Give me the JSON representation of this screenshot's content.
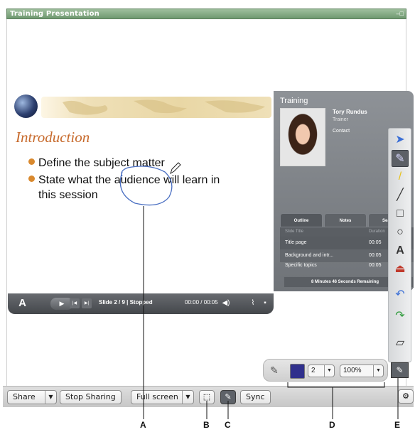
{
  "window": {
    "title": "Training Presentation",
    "controls": "–□"
  },
  "slide": {
    "title": "Introduction",
    "bullets": [
      "Define the subject matter",
      "State what the audience will learn in",
      "this session"
    ]
  },
  "player": {
    "slide_info": "Slide 2 / 9 | Stopped",
    "time": "00:00 / 00:05"
  },
  "presenter": {
    "heading": "Training",
    "name": "Tory Rundus",
    "role": "Trainer",
    "contact": "Contact"
  },
  "outline": {
    "tabs": [
      "Outline",
      "Notes",
      "Search"
    ],
    "header": {
      "left": "Slide Title",
      "right": "Duration"
    },
    "rows": [
      {
        "title": "Title page",
        "time": "00:05"
      },
      {
        "title": "Background and intr...",
        "time": "00:05"
      },
      {
        "title": "Specific topics",
        "time": "00:05"
      }
    ],
    "remaining": "8 Minutes 46 Seconds Remaining"
  },
  "drawing_tools": [
    "pointer-icon",
    "pen-icon",
    "highlighter-icon",
    "line-icon",
    "rectangle-icon",
    "ellipse-icon",
    "text-icon",
    "stamp-icon",
    "undo-icon",
    "redo-icon",
    "eraser-icon"
  ],
  "pen_options": {
    "color": "#2f2f8c",
    "thickness": "2",
    "zoom": "100%"
  },
  "toolbar": {
    "share": "Share",
    "stop_sharing": "Stop Sharing",
    "full_screen": "Full screen",
    "sync": "Sync"
  },
  "callouts": [
    "A",
    "B",
    "C",
    "D",
    "E"
  ]
}
